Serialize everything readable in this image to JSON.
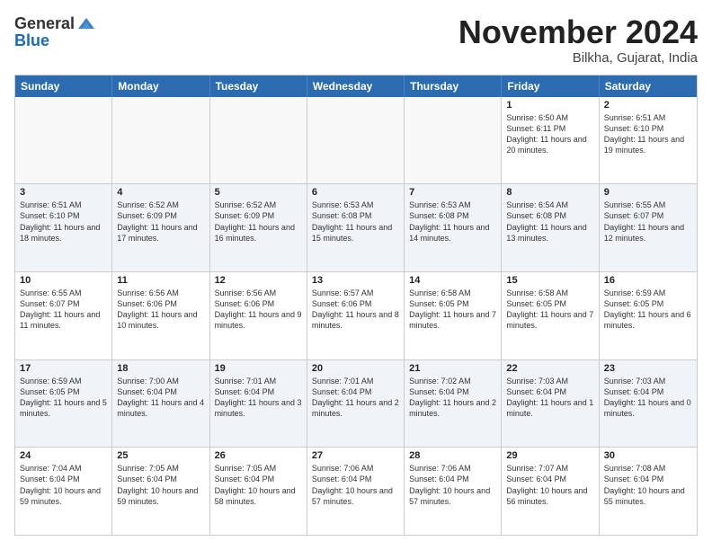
{
  "logo": {
    "general": "General",
    "blue": "Blue"
  },
  "header": {
    "month": "November 2024",
    "location": "Bilkha, Gujarat, India"
  },
  "weekdays": [
    "Sunday",
    "Monday",
    "Tuesday",
    "Wednesday",
    "Thursday",
    "Friday",
    "Saturday"
  ],
  "rows": [
    [
      {
        "day": "",
        "sunrise": "",
        "sunset": "",
        "daylight": "",
        "empty": true
      },
      {
        "day": "",
        "sunrise": "",
        "sunset": "",
        "daylight": "",
        "empty": true
      },
      {
        "day": "",
        "sunrise": "",
        "sunset": "",
        "daylight": "",
        "empty": true
      },
      {
        "day": "",
        "sunrise": "",
        "sunset": "",
        "daylight": "",
        "empty": true
      },
      {
        "day": "",
        "sunrise": "",
        "sunset": "",
        "daylight": "",
        "empty": true
      },
      {
        "day": "1",
        "sunrise": "Sunrise: 6:50 AM",
        "sunset": "Sunset: 6:11 PM",
        "daylight": "Daylight: 11 hours and 20 minutes.",
        "empty": false
      },
      {
        "day": "2",
        "sunrise": "Sunrise: 6:51 AM",
        "sunset": "Sunset: 6:10 PM",
        "daylight": "Daylight: 11 hours and 19 minutes.",
        "empty": false
      }
    ],
    [
      {
        "day": "3",
        "sunrise": "Sunrise: 6:51 AM",
        "sunset": "Sunset: 6:10 PM",
        "daylight": "Daylight: 11 hours and 18 minutes.",
        "empty": false
      },
      {
        "day": "4",
        "sunrise": "Sunrise: 6:52 AM",
        "sunset": "Sunset: 6:09 PM",
        "daylight": "Daylight: 11 hours and 17 minutes.",
        "empty": false
      },
      {
        "day": "5",
        "sunrise": "Sunrise: 6:52 AM",
        "sunset": "Sunset: 6:09 PM",
        "daylight": "Daylight: 11 hours and 16 minutes.",
        "empty": false
      },
      {
        "day": "6",
        "sunrise": "Sunrise: 6:53 AM",
        "sunset": "Sunset: 6:08 PM",
        "daylight": "Daylight: 11 hours and 15 minutes.",
        "empty": false
      },
      {
        "day": "7",
        "sunrise": "Sunrise: 6:53 AM",
        "sunset": "Sunset: 6:08 PM",
        "daylight": "Daylight: 11 hours and 14 minutes.",
        "empty": false
      },
      {
        "day": "8",
        "sunrise": "Sunrise: 6:54 AM",
        "sunset": "Sunset: 6:08 PM",
        "daylight": "Daylight: 11 hours and 13 minutes.",
        "empty": false
      },
      {
        "day": "9",
        "sunrise": "Sunrise: 6:55 AM",
        "sunset": "Sunset: 6:07 PM",
        "daylight": "Daylight: 11 hours and 12 minutes.",
        "empty": false
      }
    ],
    [
      {
        "day": "10",
        "sunrise": "Sunrise: 6:55 AM",
        "sunset": "Sunset: 6:07 PM",
        "daylight": "Daylight: 11 hours and 11 minutes.",
        "empty": false
      },
      {
        "day": "11",
        "sunrise": "Sunrise: 6:56 AM",
        "sunset": "Sunset: 6:06 PM",
        "daylight": "Daylight: 11 hours and 10 minutes.",
        "empty": false
      },
      {
        "day": "12",
        "sunrise": "Sunrise: 6:56 AM",
        "sunset": "Sunset: 6:06 PM",
        "daylight": "Daylight: 11 hours and 9 minutes.",
        "empty": false
      },
      {
        "day": "13",
        "sunrise": "Sunrise: 6:57 AM",
        "sunset": "Sunset: 6:06 PM",
        "daylight": "Daylight: 11 hours and 8 minutes.",
        "empty": false
      },
      {
        "day": "14",
        "sunrise": "Sunrise: 6:58 AM",
        "sunset": "Sunset: 6:05 PM",
        "daylight": "Daylight: 11 hours and 7 minutes.",
        "empty": false
      },
      {
        "day": "15",
        "sunrise": "Sunrise: 6:58 AM",
        "sunset": "Sunset: 6:05 PM",
        "daylight": "Daylight: 11 hours and 7 minutes.",
        "empty": false
      },
      {
        "day": "16",
        "sunrise": "Sunrise: 6:59 AM",
        "sunset": "Sunset: 6:05 PM",
        "daylight": "Daylight: 11 hours and 6 minutes.",
        "empty": false
      }
    ],
    [
      {
        "day": "17",
        "sunrise": "Sunrise: 6:59 AM",
        "sunset": "Sunset: 6:05 PM",
        "daylight": "Daylight: 11 hours and 5 minutes.",
        "empty": false
      },
      {
        "day": "18",
        "sunrise": "Sunrise: 7:00 AM",
        "sunset": "Sunset: 6:04 PM",
        "daylight": "Daylight: 11 hours and 4 minutes.",
        "empty": false
      },
      {
        "day": "19",
        "sunrise": "Sunrise: 7:01 AM",
        "sunset": "Sunset: 6:04 PM",
        "daylight": "Daylight: 11 hours and 3 minutes.",
        "empty": false
      },
      {
        "day": "20",
        "sunrise": "Sunrise: 7:01 AM",
        "sunset": "Sunset: 6:04 PM",
        "daylight": "Daylight: 11 hours and 2 minutes.",
        "empty": false
      },
      {
        "day": "21",
        "sunrise": "Sunrise: 7:02 AM",
        "sunset": "Sunset: 6:04 PM",
        "daylight": "Daylight: 11 hours and 2 minutes.",
        "empty": false
      },
      {
        "day": "22",
        "sunrise": "Sunrise: 7:03 AM",
        "sunset": "Sunset: 6:04 PM",
        "daylight": "Daylight: 11 hours and 1 minute.",
        "empty": false
      },
      {
        "day": "23",
        "sunrise": "Sunrise: 7:03 AM",
        "sunset": "Sunset: 6:04 PM",
        "daylight": "Daylight: 11 hours and 0 minutes.",
        "empty": false
      }
    ],
    [
      {
        "day": "24",
        "sunrise": "Sunrise: 7:04 AM",
        "sunset": "Sunset: 6:04 PM",
        "daylight": "Daylight: 10 hours and 59 minutes.",
        "empty": false
      },
      {
        "day": "25",
        "sunrise": "Sunrise: 7:05 AM",
        "sunset": "Sunset: 6:04 PM",
        "daylight": "Daylight: 10 hours and 59 minutes.",
        "empty": false
      },
      {
        "day": "26",
        "sunrise": "Sunrise: 7:05 AM",
        "sunset": "Sunset: 6:04 PM",
        "daylight": "Daylight: 10 hours and 58 minutes.",
        "empty": false
      },
      {
        "day": "27",
        "sunrise": "Sunrise: 7:06 AM",
        "sunset": "Sunset: 6:04 PM",
        "daylight": "Daylight: 10 hours and 57 minutes.",
        "empty": false
      },
      {
        "day": "28",
        "sunrise": "Sunrise: 7:06 AM",
        "sunset": "Sunset: 6:04 PM",
        "daylight": "Daylight: 10 hours and 57 minutes.",
        "empty": false
      },
      {
        "day": "29",
        "sunrise": "Sunrise: 7:07 AM",
        "sunset": "Sunset: 6:04 PM",
        "daylight": "Daylight: 10 hours and 56 minutes.",
        "empty": false
      },
      {
        "day": "30",
        "sunrise": "Sunrise: 7:08 AM",
        "sunset": "Sunset: 6:04 PM",
        "daylight": "Daylight: 10 hours and 55 minutes.",
        "empty": false
      }
    ]
  ]
}
